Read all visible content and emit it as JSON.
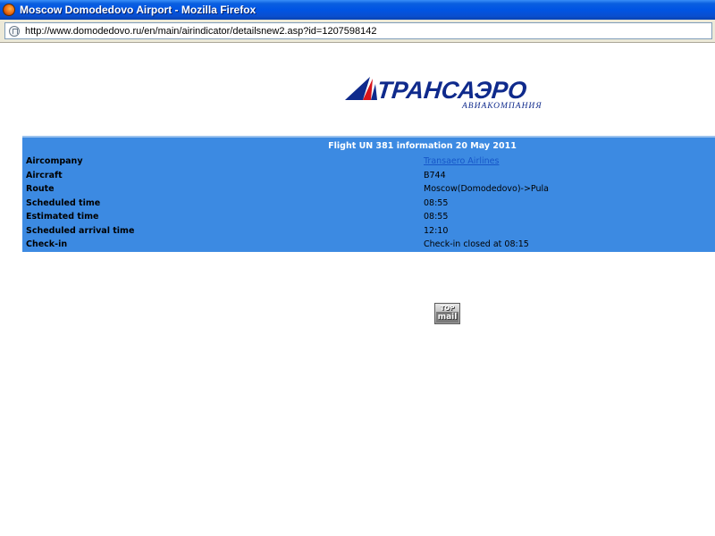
{
  "window": {
    "title": "Moscow Domodedovo Airport - Mozilla Firefox"
  },
  "address_bar": {
    "url": "http://www.domodedovo.ru/en/main/airindicator/detailsnew2.asp?id=1207598142"
  },
  "logo": {
    "name": "ТРАНСАЭРО",
    "subtitle": "АВИАКОМПАНИЯ"
  },
  "flight": {
    "header": "Flight UN 381 information 20 May 2011",
    "rows": [
      {
        "label": "Aircompany",
        "value": "Transaero Airlines",
        "is_link": true
      },
      {
        "label": "Aircraft",
        "value": "B744"
      },
      {
        "label": "Route",
        "value": "Moscow(Domodedovo)->Pula"
      },
      {
        "label": "Scheduled time",
        "value": "08:55"
      },
      {
        "label": "Estimated time",
        "value": "08:55"
      },
      {
        "label": "Scheduled arrival time",
        "value": "12:10"
      },
      {
        "label": "Check-in",
        "value": "Check-in closed at 08:15"
      }
    ]
  },
  "counter": {
    "line1": "TOP",
    "line2": "mail"
  },
  "colors": {
    "table_bg": "#3c8ae2",
    "logo_blue": "#0f2a8c",
    "logo_red": "#d8141b",
    "titlebar": "#0054e3"
  }
}
